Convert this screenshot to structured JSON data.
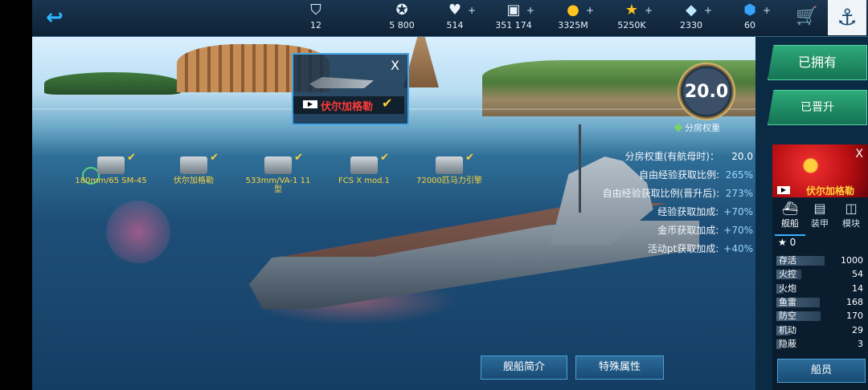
{
  "topbar": {
    "resources": [
      {
        "name": "rank-icon",
        "value": "12",
        "has_plus": false
      },
      {
        "name": "experience-icon",
        "value": "5 800",
        "has_plus": false
      },
      {
        "name": "heart-icon",
        "value": "514",
        "has_plus": true
      },
      {
        "name": "book-icon",
        "value": "351 174",
        "has_plus": true
      },
      {
        "name": "coin-icon",
        "value": "3325M",
        "has_plus": true
      },
      {
        "name": "star-icon",
        "value": "5250K",
        "has_plus": true
      },
      {
        "name": "diamond-icon",
        "value": "2330",
        "has_plus": true
      },
      {
        "name": "gem-icon",
        "value": "60",
        "has_plus": true
      }
    ]
  },
  "popup": {
    "close": "X",
    "ship_name": "伏尔加格勒"
  },
  "modules": [
    {
      "label": "180mm/65 SM-45"
    },
    {
      "label": "伏尔加格勒"
    },
    {
      "label": "533mm/VA-1 11型"
    },
    {
      "label": "FCS X mod.1"
    },
    {
      "label": "72000匹马力引擎"
    }
  ],
  "rating": {
    "value": "20.0",
    "label": "分房权重"
  },
  "stats": [
    {
      "label": "分房权重(有航母时)：",
      "value": "20.0"
    },
    {
      "label": "自由经验获取比例:",
      "value": "265%"
    },
    {
      "label": "自由经验获取比例(晋升后):",
      "value": "273%"
    },
    {
      "label": "经验获取加成:",
      "value": "+70%"
    },
    {
      "label": "金币获取加成:",
      "value": "+70%"
    },
    {
      "label": "活动pt获取加成:",
      "value": "+40%"
    }
  ],
  "bottom_buttons": {
    "intro": "舰船简介",
    "special": "特殊属性"
  },
  "right": {
    "owned": "已拥有",
    "promoted": "已晋升",
    "close": "X",
    "ship_name": "伏尔加格勒",
    "tabs": [
      "舰船",
      "装甲",
      "模块"
    ],
    "stars": "0",
    "attributes": [
      {
        "label": "存活",
        "value": 1000,
        "fill": 1.0
      },
      {
        "label": "火控",
        "value": 54,
        "fill": 0.52
      },
      {
        "label": "火炮",
        "value": 14,
        "fill": 0.15
      },
      {
        "label": "鱼雷",
        "value": 168,
        "fill": 0.9
      },
      {
        "label": "防空",
        "value": 170,
        "fill": 0.92
      },
      {
        "label": "机动",
        "value": 29,
        "fill": 0.3
      },
      {
        "label": "隐蔽",
        "value": 3,
        "fill": 0.05
      }
    ],
    "crew": "船员"
  }
}
